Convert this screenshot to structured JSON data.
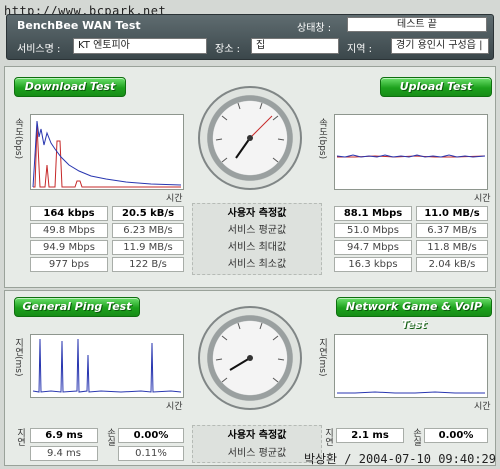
{
  "watermark": {
    "site": "http://www.bcpark.net",
    "footer": "박상환 / 2004-07-10 09:40:29"
  },
  "header": {
    "title": "BenchBee WAN Test",
    "status_label": "상태창 :",
    "status_value": "테스트 끝",
    "provider_label": "서비스명 :",
    "provider_value": "KT 엔토피아",
    "place_label": "장소 :",
    "place_value": "집",
    "region_label": "지역 :",
    "region_value": "경기 용인시 구성읍 |"
  },
  "download": {
    "button": "Download Test",
    "ylabel": "속도(bps)",
    "xlabel": "시간",
    "rows": [
      {
        "bps": "164 kbps",
        "bytes": "20.5 kB/s"
      },
      {
        "bps": "49.8 Mbps",
        "bytes": "6.23 MB/s"
      },
      {
        "bps": "94.9 Mbps",
        "bytes": "11.9 MB/s"
      },
      {
        "bps": "977 bps",
        "bytes": "122 B/s"
      }
    ]
  },
  "upload": {
    "button": "Upload Test",
    "ylabel": "속도(bps)",
    "xlabel": "시간",
    "rows": [
      {
        "bps": "88.1 Mbps",
        "bytes": "11.0 MB/s"
      },
      {
        "bps": "51.0 Mbps",
        "bytes": "6.37 MB/s"
      },
      {
        "bps": "94.7 Mbps",
        "bytes": "11.8 MB/s"
      },
      {
        "bps": "16.3 kbps",
        "bytes": "2.04 kB/s"
      }
    ]
  },
  "center_labels": [
    "사용자 측정값",
    "서비스 평균값",
    "서비스 최대값",
    "서비스 최소값"
  ],
  "gauge_top": {
    "ticks": [
      "0K",
      "10K",
      "100K",
      "1M",
      "10M",
      "100M"
    ]
  },
  "gauge_bottom": {
    "ticks": [
      "0",
      "10",
      "20",
      "30",
      "40",
      "50",
      "60",
      "70",
      "80",
      "90",
      "100",
      "110",
      "120"
    ]
  },
  "ping": {
    "button": "General Ping Test",
    "ylabel": "지연(ms)",
    "xlabel": "시간",
    "side_delay": "지연",
    "side_loss": "손실",
    "side_avg": "지연",
    "side_avg_loss": "손실",
    "rows": [
      {
        "delay": "6.9 ms",
        "loss": "0.00%"
      },
      {
        "delay": "9.4 ms",
        "loss": "0.11%"
      }
    ]
  },
  "game": {
    "button": "Network Game & VoIP Test",
    "ylabel": "지연(ms)",
    "xlabel": "시간",
    "side_delay": "지연",
    "side_loss": "손실",
    "rows": [
      {
        "delay": "2.1 ms",
        "loss": "0.00%"
      }
    ]
  },
  "center_labels_bottom": [
    "사용자 측정값",
    "서비스 평균값"
  ]
}
